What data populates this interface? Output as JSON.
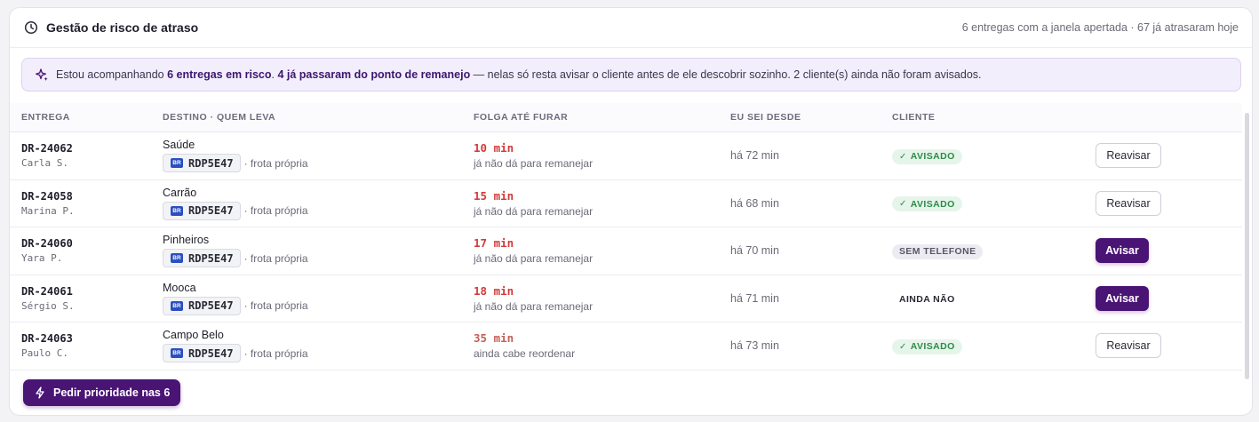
{
  "header": {
    "title": "Gestão de risco de atraso",
    "summary": "6 entregas com a janela apertada · 67 já atrasaram hoje"
  },
  "banner": {
    "lead": "Estou acompanhando ",
    "strong1": "6 entregas em risco",
    "mid": ". ",
    "strong2": "4 já passaram do ponto de remanejo",
    "tail": " — nelas só resta avisar o cliente antes de ele descobrir sozinho. 2 cliente(s) ainda não foram avisados."
  },
  "table": {
    "columns": [
      "ENTREGA",
      "DESTINO · QUEM LEVA",
      "FOLGA ATÉ FURAR",
      "EU SEI DESDE",
      "CLIENTE"
    ],
    "rows": [
      {
        "code": "DR-24062",
        "person": "Carla S.",
        "dest": "Saúde",
        "flag": "BR",
        "plate": "RDP5E47",
        "fleet": "· frota própria",
        "slack": "10 min",
        "slack_note": "já não dá para remanejar",
        "since": "há 72 min",
        "status": "AVISADO",
        "status_kind": "ok",
        "action": "Reavisar",
        "action_kind": "ghost"
      },
      {
        "code": "DR-24058",
        "person": "Marina P.",
        "dest": "Carrão",
        "flag": "BR",
        "plate": "RDP5E47",
        "fleet": "· frota própria",
        "slack": "15 min",
        "slack_note": "já não dá para remanejar",
        "since": "há 68 min",
        "status": "AVISADO",
        "status_kind": "ok",
        "action": "Reavisar",
        "action_kind": "ghost"
      },
      {
        "code": "DR-24060",
        "person": "Yara P.",
        "dest": "Pinheiros",
        "flag": "BR",
        "plate": "RDP5E47",
        "fleet": "· frota própria",
        "slack": "17 min",
        "slack_note": "já não dá para remanejar",
        "since": "há 70 min",
        "status": "SEM TELEFONE",
        "status_kind": "nophone",
        "action": "Avisar",
        "action_kind": "primary"
      },
      {
        "code": "DR-24061",
        "person": "Sérgio S.",
        "dest": "Mooca",
        "flag": "BR",
        "plate": "RDP5E47",
        "fleet": "· frota própria",
        "slack": "18 min",
        "slack_note": "já não dá para remanejar",
        "since": "há 71 min",
        "status": "AINDA NÃO",
        "status_kind": "none",
        "action": "Avisar",
        "action_kind": "primary"
      },
      {
        "code": "DR-24063",
        "person": "Paulo C.",
        "dest": "Campo Belo",
        "flag": "BR",
        "plate": "RDP5E47",
        "fleet": "· frota própria",
        "slack": "35 min",
        "slack_note": "ainda cabe reordenar",
        "since": "há 73 min",
        "status": "AVISADO",
        "status_kind": "ok",
        "action": "Reavisar",
        "action_kind": "ghost"
      }
    ]
  },
  "footer": {
    "priority_button": "Pedir prioridade nas 6"
  },
  "icons": {
    "header": "clock-icon",
    "banner": "sparkle-icon",
    "check": "check-icon",
    "footer": "lightning-icon"
  },
  "colors": {
    "accent": "#4a1475",
    "danger": "#d23a3a",
    "success": "#2f8a4a",
    "banner_bg": "#f3eefb"
  }
}
